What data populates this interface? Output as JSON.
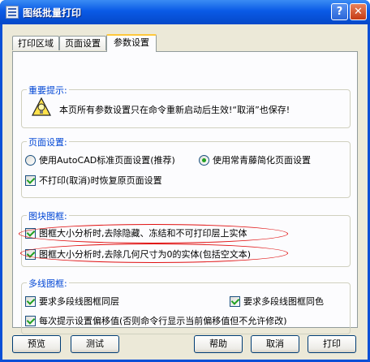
{
  "window": {
    "title": "图纸批量打印",
    "help_button": "?",
    "close_button": "✕"
  },
  "tabs": [
    {
      "label": "打印区域"
    },
    {
      "label": "页面设置"
    },
    {
      "label": "参数设置",
      "active": true
    }
  ],
  "notice_group": {
    "title": "重要提示:",
    "text": "本页所有参数设置只在命令重新启动后生效!“取消”也保存!"
  },
  "page_group": {
    "title": "页面设置:",
    "radio_autocad": {
      "label": "使用AutoCAD标准页面设置(推荐)",
      "checked": false
    },
    "radio_simplified": {
      "label": "使用常青藤简化页面设置",
      "checked": true
    },
    "check_restore": {
      "label": "不打印(取消)时恢复原页面设置",
      "checked": true
    }
  },
  "block_group": {
    "title": "图块图框:",
    "check_exclude_hidden": {
      "label": "图框大小分析时,去除隐藏、冻结和不可打印层上实体",
      "checked": true
    },
    "check_exclude_zero": {
      "label": "图框大小分析时,去除几何尺寸为0的实体(包括空文本)",
      "checked": true
    }
  },
  "polyline_group": {
    "title": "多线图框:",
    "check_same_layer": {
      "label": "要求多段线图框同层",
      "checked": true
    },
    "check_same_color": {
      "label": "要求多段线图框同色",
      "checked": true
    },
    "check_prompt_offset": {
      "label": "每次提示设置偏移值(否则命令行显示当前偏移值但不允许修改)",
      "checked": true
    }
  },
  "buttons": {
    "preview": "预览",
    "test": "测试",
    "help": "帮助",
    "cancel": "取消",
    "print": "打印"
  },
  "colors": {
    "title_bar": "#0a5ae6",
    "group_title": "#0046d5",
    "annotation": "#e01010",
    "check": "#21a121"
  }
}
